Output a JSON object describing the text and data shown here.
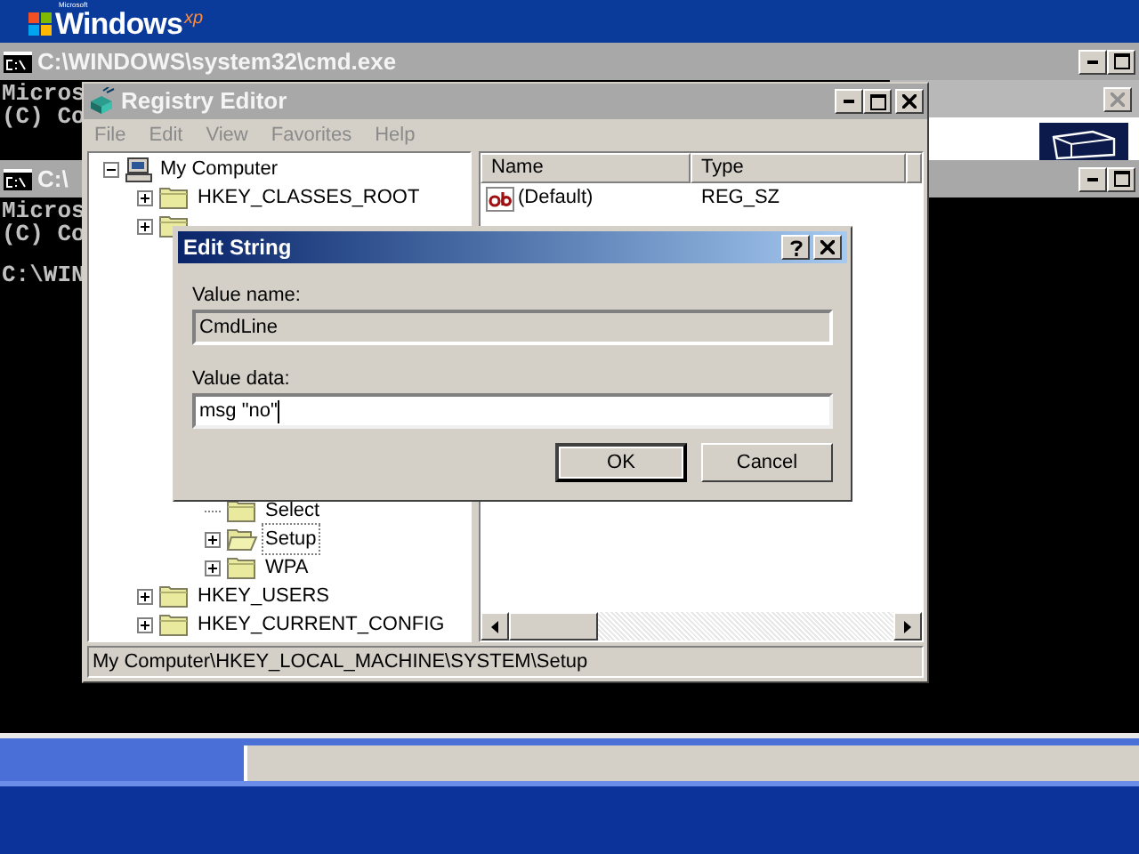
{
  "desktop_logo": {
    "maker": "Microsoft",
    "product": "Windows",
    "edition": "xp"
  },
  "console_windows": [
    {
      "title": "C:\\WINDOWS\\system32\\cmd.exe",
      "lines": [
        "Micros",
        "(C) Co"
      ]
    },
    {
      "title": "C:\\",
      "lines": [
        "Micros",
        "(C) Co",
        "C:\\WIN"
      ]
    }
  ],
  "registry_editor": {
    "title": "Registry Editor",
    "menu": [
      "File",
      "Edit",
      "View",
      "Favorites",
      "Help"
    ],
    "tree_upper": [
      {
        "label": "My Computer",
        "kind": "computer",
        "has_children": true,
        "expanded": true,
        "selected": false,
        "children": [
          {
            "label": "HKEY_CLASSES_ROOT",
            "kind": "folder",
            "has_children": true,
            "expanded": false,
            "selected": false
          },
          {
            "kind": "folder",
            "has_children": true,
            "expanded": false,
            "selected": false
          }
        ]
      }
    ],
    "tree_lower": [
      {
        "children": [
          {
            "children": [
              {
                "label": "Select",
                "kind": "folder",
                "has_children": false,
                "selected": false
              },
              {
                "label": "Setup",
                "kind": "folder",
                "has_children": true,
                "expanded": false,
                "selected": true
              },
              {
                "label": "WPA",
                "kind": "folder",
                "has_children": true,
                "expanded": false,
                "selected": false
              }
            ]
          }
        ]
      },
      {
        "label": "HKEY_USERS",
        "kind": "folder",
        "has_children": true,
        "expanded": false,
        "selected": false
      },
      {
        "label": "HKEY_CURRENT_CONFIG",
        "kind": "folder",
        "has_children": true,
        "expanded": false,
        "selected": false
      }
    ],
    "list": {
      "columns": [
        "Name",
        "Type"
      ],
      "rows": [
        {
          "name": "(Default)",
          "type": "REG_SZ"
        }
      ]
    },
    "status_bar": "My Computer\\HKEY_LOCAL_MACHINE\\SYSTEM\\Setup"
  },
  "dialog": {
    "title": "Edit String",
    "value_name_label": "Value name:",
    "value_name": "CmdLine",
    "value_data_label": "Value data:",
    "value_data": "msg \"no\"",
    "buttons": [
      {
        "label": "OK",
        "default": true
      },
      {
        "label": "Cancel",
        "default": false
      }
    ]
  }
}
